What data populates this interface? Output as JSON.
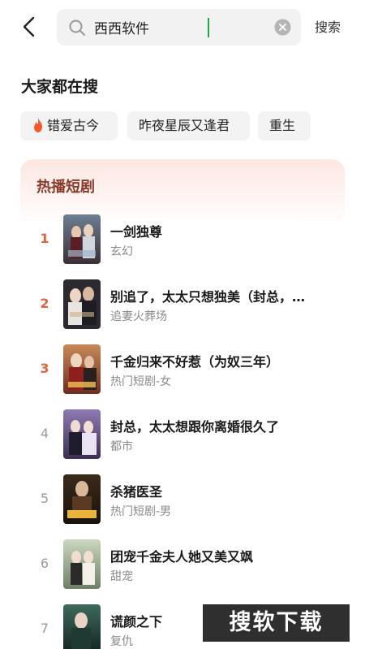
{
  "search": {
    "value": "西西软件",
    "submit_label": "搜索"
  },
  "hot_search": {
    "title": "大家都在搜",
    "chips": [
      "错爱古今",
      "昨夜星辰又逢君",
      "重生"
    ]
  },
  "ranking": {
    "title": "热播短剧",
    "items": [
      {
        "rank": "1",
        "title": "一剑独尊",
        "tag": "玄幻"
      },
      {
        "rank": "2",
        "title": "别追了，太太只想独美（封总，…",
        "tag": "追妻火葬场"
      },
      {
        "rank": "3",
        "title": "千金归来不好惹（为奴三年）",
        "tag": "热门短剧-女"
      },
      {
        "rank": "4",
        "title": "封总，太太想跟你离婚很久了",
        "tag": "都市"
      },
      {
        "rank": "5",
        "title": "杀猪医圣",
        "tag": "热门短剧-男"
      },
      {
        "rank": "6",
        "title": "团宠千金夫人她又美又飒",
        "tag": "甜宠"
      },
      {
        "rank": "7",
        "title": "谎颜之下",
        "tag": "复仇"
      }
    ]
  },
  "watermark": "搜软下载",
  "colors": {
    "accent_rank": "#e2643e",
    "ranking_title": "#8b3a2a",
    "cursor": "#1fa64a"
  }
}
